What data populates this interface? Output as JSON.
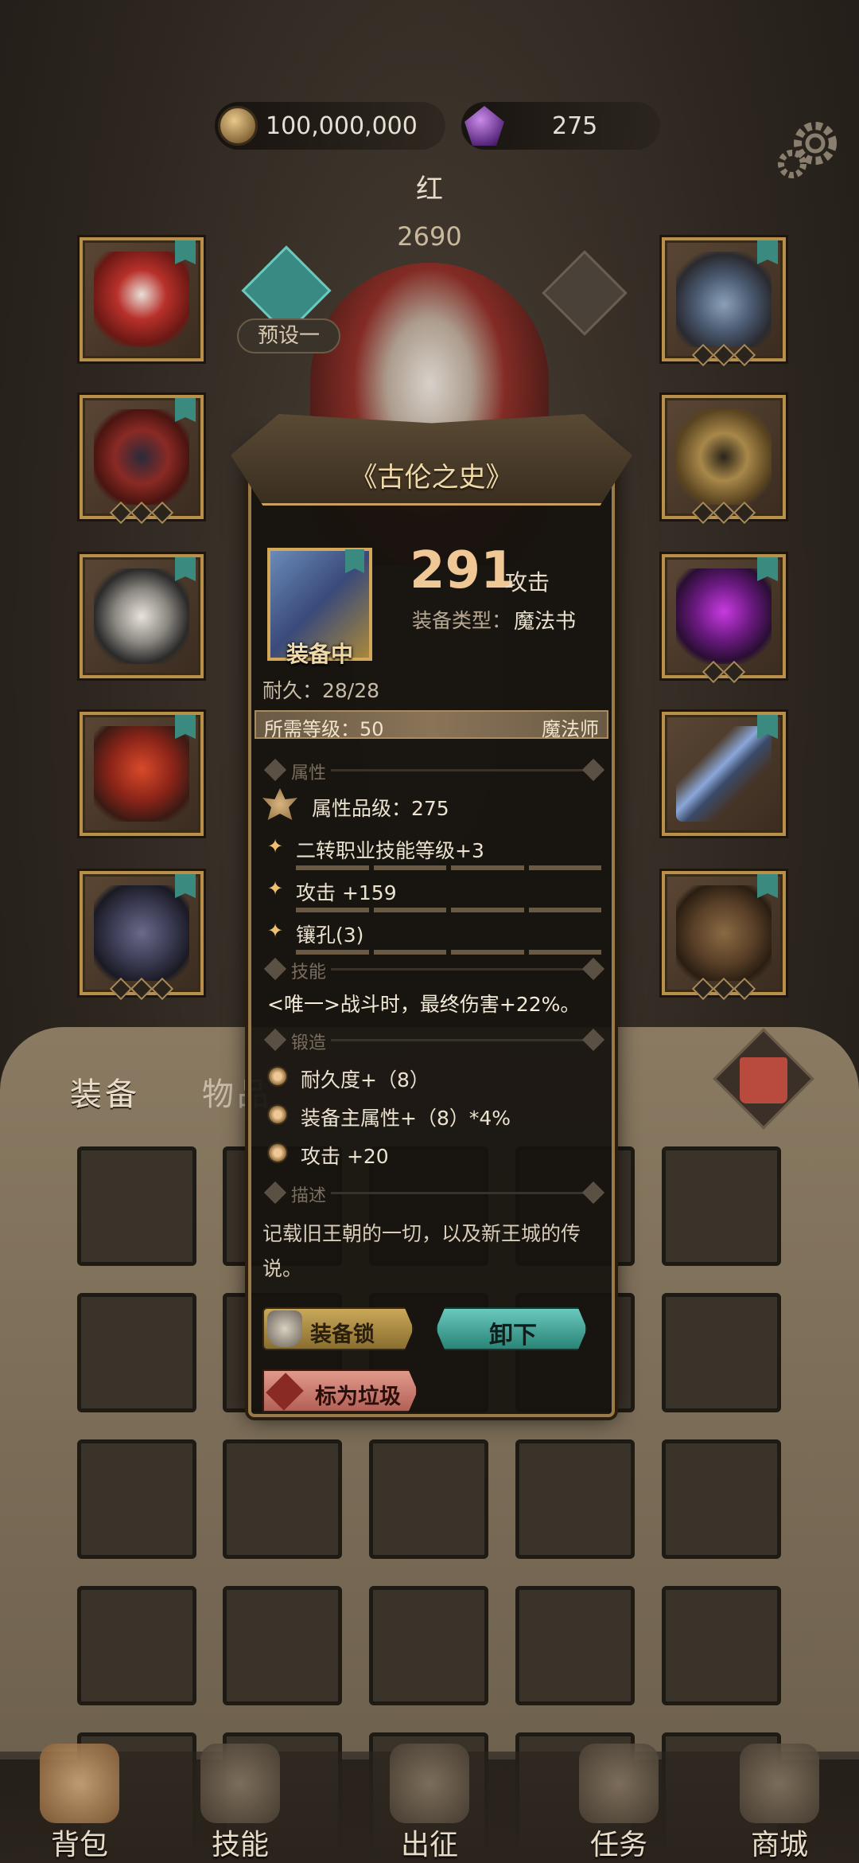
{
  "resources": {
    "gold": "100,000,000",
    "gems": "275"
  },
  "character": {
    "name": "红",
    "power": "2690",
    "preset_label": "预设一"
  },
  "bag": {
    "tab_equipment": "装备",
    "tab_items": "物品"
  },
  "nav": [
    {
      "label": "背包",
      "icon": "backpack-icon"
    },
    {
      "label": "技能",
      "icon": "skill-book-icon"
    },
    {
      "label": "出征",
      "icon": "sword-map-icon"
    },
    {
      "label": "任务",
      "icon": "quest-scroll-icon"
    },
    {
      "label": "商城",
      "icon": "shop-crown-icon"
    }
  ],
  "item": {
    "title": "《古伦之史》",
    "attack_value": "291",
    "attack_label": "攻击",
    "type_label": "装备类型：",
    "type_value": "魔法书",
    "equipped_label": "装备中",
    "durability": "耐久：28/28",
    "required_level": "所需等级：50",
    "required_class": "魔法师",
    "sections": {
      "attributes": "属性",
      "skills": "技能",
      "forge": "锻造",
      "description": "描述"
    },
    "quality": "属性品级：275",
    "attributes": [
      "二转职业技能等级+3",
      "攻击 +159",
      "镶孔(3)"
    ],
    "skill": "<唯一>战斗时，最终伤害+22%。",
    "forge": [
      "耐久度+（8）",
      "装备主属性+（8）*4%",
      "攻击 +20"
    ],
    "description": "记载旧王朝的一切，以及新王城的传说。",
    "buttons": {
      "lock": "装备锁",
      "unequip": "卸下",
      "junk": "标为垃圾"
    }
  },
  "colors": {
    "gold_accent": "#c9a060",
    "teal_button": "#4ab0a4",
    "junk_button": "#d88478",
    "lock_button": "#b8944a"
  }
}
